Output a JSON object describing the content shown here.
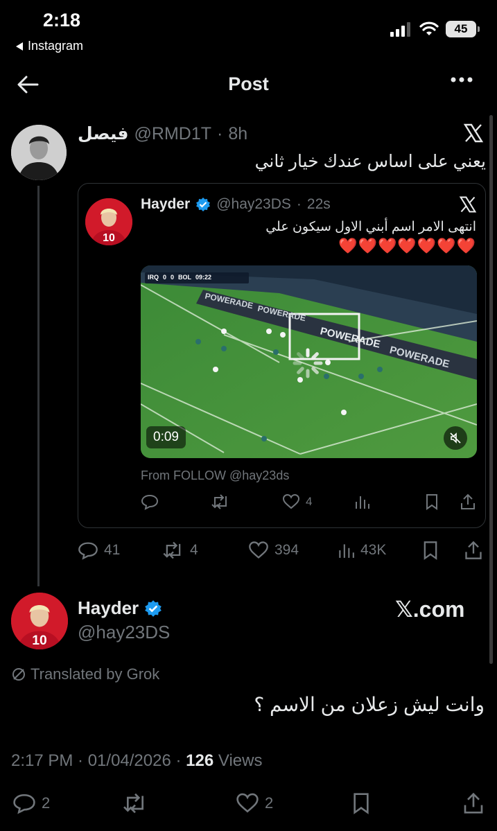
{
  "status_bar": {
    "time": "2:18",
    "back_app": "Instagram",
    "battery": "45"
  },
  "header": {
    "title": "Post"
  },
  "tweet": {
    "author_name": "فيصل",
    "handle": "@RMD1T",
    "separator": "·",
    "time_ago": "8h",
    "text": "يعني على اساس عندك خيار ثاني",
    "stats": {
      "replies": "41",
      "reposts": "4",
      "likes": "394",
      "views": "43K"
    }
  },
  "quoted": {
    "author_name": "Hayder",
    "handle": "@hay23DS",
    "separator": "·",
    "time_ago": "22s",
    "text": "انتهى الامر اسم أبني الاول سيكون علي",
    "hearts": "❤️❤️❤️❤️❤️❤️❤️",
    "video_duration": "0:09",
    "scoreboard": {
      "team1": "IRQ",
      "score1": "0",
      "score2": "0",
      "team2": "BOL",
      "clock": "09:22"
    },
    "boards": [
      "POWERADE",
      "POWERADE",
      "POWERADE",
      "POWERADE"
    ],
    "from_label": "From FOLLOW @hay23ds",
    "stats": {
      "likes": "4"
    }
  },
  "reply": {
    "author_name": "Hayder",
    "handle": "@hay23DS",
    "brand": "𝕏.com",
    "translated": "Translated by Grok",
    "text": "وانت ليش زعلان من الاسم ؟",
    "timestamp": "2:17 PM · 01/04/2026 · ",
    "views_count": "126",
    "views_label": " Views",
    "stats": {
      "replies": "2",
      "likes": "2"
    }
  },
  "colors": {
    "verified": "#1d9bf0",
    "muted": "#71767b",
    "text": "#e7e9ea",
    "heart": "#e0102a"
  }
}
